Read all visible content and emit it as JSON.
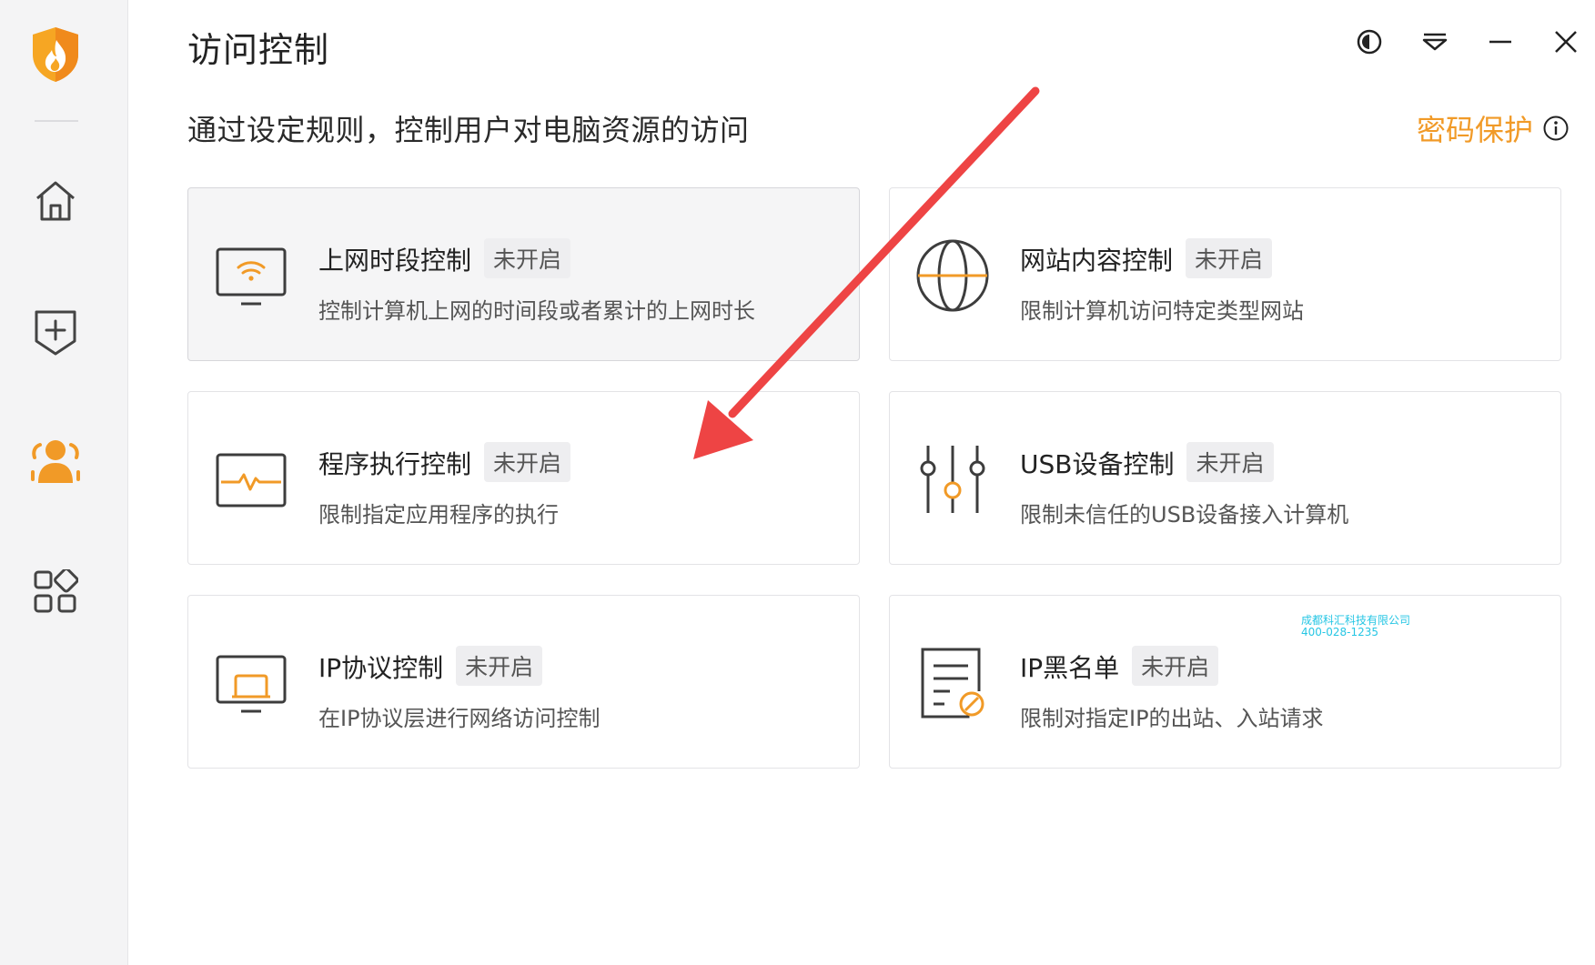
{
  "app": {
    "title": "访问控制",
    "subtitle": "通过设定规则，控制用户对电脑资源的访问",
    "password_protect": "密码保护"
  },
  "sidebar": {
    "items": [
      {
        "name": "home",
        "icon": "home-icon",
        "active": false
      },
      {
        "name": "protection",
        "icon": "shield-plus-icon",
        "active": false
      },
      {
        "name": "access-control",
        "icon": "users-icon",
        "active": true
      },
      {
        "name": "apps",
        "icon": "apps-grid-icon",
        "active": false
      }
    ]
  },
  "window_controls": [
    "theme-toggle-icon",
    "menu-dropdown-icon",
    "minimize-icon",
    "close-icon"
  ],
  "cards": [
    {
      "title": "上网时段控制",
      "status": "未开启",
      "desc": "控制计算机上网的时间段或者累计的上网时长",
      "icon": "monitor-wifi-icon"
    },
    {
      "title": "网站内容控制",
      "status": "未开启",
      "desc": "限制计算机访问特定类型网站",
      "icon": "globe-icon"
    },
    {
      "title": "程序执行控制",
      "status": "未开启",
      "desc": "限制指定应用程序的执行",
      "icon": "monitor-pulse-icon"
    },
    {
      "title": "USB设备控制",
      "status": "未开启",
      "desc": "限制未信任的USB设备接入计算机",
      "icon": "sliders-icon"
    },
    {
      "title": "IP协议控制",
      "status": "未开启",
      "desc": "在IP协议层进行网络访问控制",
      "icon": "monitor-window-icon"
    },
    {
      "title": "IP黑名单",
      "status": "未开启",
      "desc": "限制对指定IP的出站、入站请求",
      "icon": "document-block-icon"
    }
  ],
  "watermark": {
    "line1": "成都科汇科技有限公司",
    "line2": "400-028-1235"
  },
  "colors": {
    "accent": "#f19a27",
    "icon_stroke": "#3d3d3d",
    "arrow": "#ee4444"
  }
}
